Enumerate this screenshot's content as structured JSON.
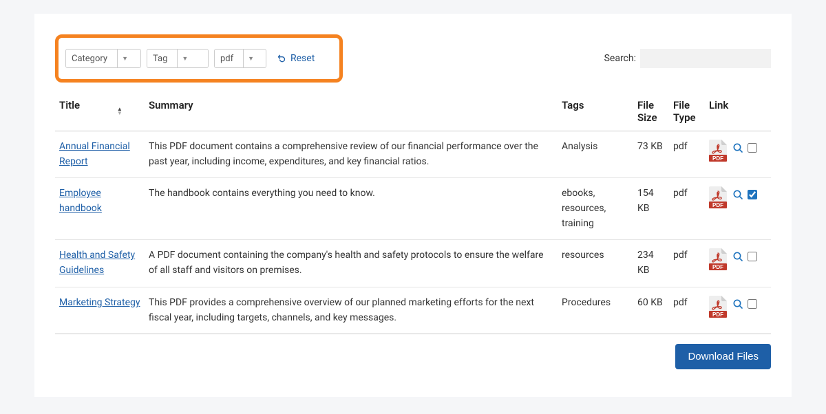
{
  "filters": {
    "category": {
      "label": "Category"
    },
    "tag": {
      "label": "Tag"
    },
    "type": {
      "label": "pdf"
    },
    "reset": "Reset"
  },
  "search": {
    "label": "Search:",
    "value": ""
  },
  "table": {
    "headers": {
      "title": "Title",
      "summary": "Summary",
      "tags": "Tags",
      "size": "File Size",
      "type": "File Type",
      "link": "Link"
    },
    "rows": [
      {
        "title": "Annual Financial Report",
        "summary": "This PDF document contains a comprehensive review of our financial performance over the past year, including income, expenditures, and key financial ratios.",
        "tags": "Analysis",
        "size": "73 KB",
        "type": "pdf",
        "checked": false
      },
      {
        "title": "Employee handbook",
        "summary": "The handbook contains everything you need to know.",
        "tags": "ebooks, resources, training",
        "size": "154 KB",
        "type": "pdf",
        "checked": true
      },
      {
        "title": "Health and Safety Guidelines",
        "summary": "A PDF document containing the company's health and safety protocols to ensure the welfare of all staff and visitors on premises.",
        "tags": "resources",
        "size": "234 KB",
        "type": "pdf",
        "checked": false
      },
      {
        "title": "Marketing Strategy",
        "summary": "This PDF provides a comprehensive overview of our planned marketing efforts for the next fiscal year, including targets, channels, and key messages.",
        "tags": "Procedures",
        "size": "60 KB",
        "type": "pdf",
        "checked": false
      }
    ]
  },
  "actions": {
    "download": "Download Files"
  }
}
